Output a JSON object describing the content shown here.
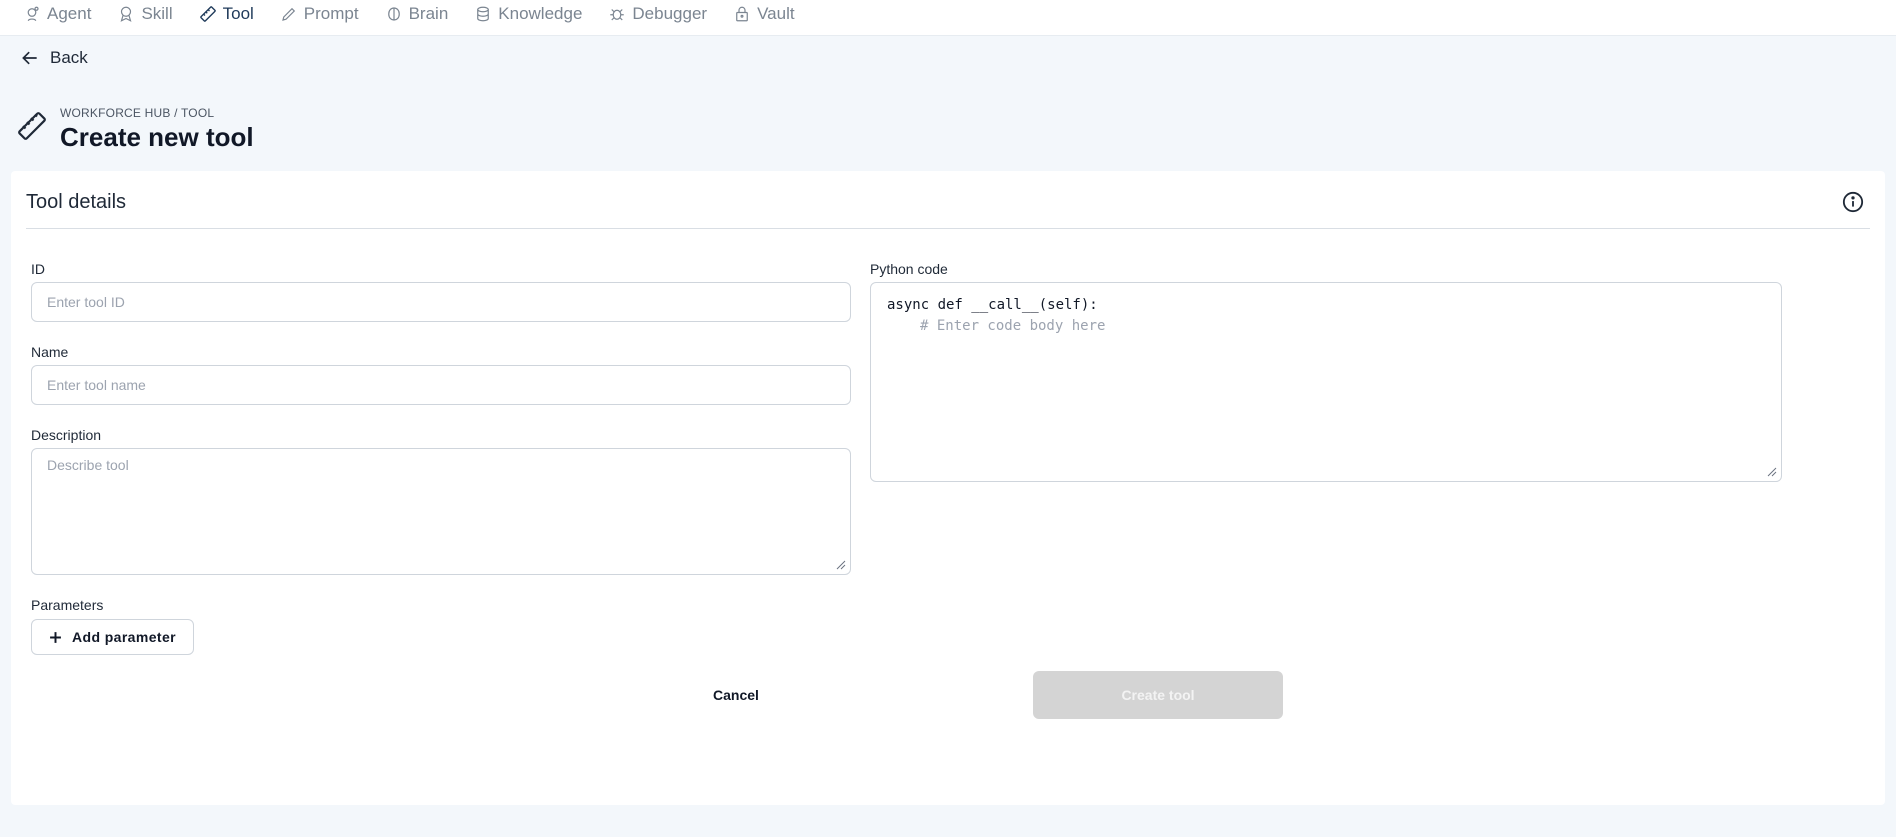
{
  "nav": {
    "items": [
      {
        "label": "Agent",
        "icon": "agent-icon"
      },
      {
        "label": "Skill",
        "icon": "skill-icon"
      },
      {
        "label": "Tool",
        "icon": "tool-icon",
        "active": true
      },
      {
        "label": "Prompt",
        "icon": "prompt-icon"
      },
      {
        "label": "Brain",
        "icon": "brain-icon"
      },
      {
        "label": "Knowledge",
        "icon": "database-icon"
      },
      {
        "label": "Debugger",
        "icon": "bug-icon"
      },
      {
        "label": "Vault",
        "icon": "lock-icon"
      }
    ]
  },
  "back_label": "Back",
  "header": {
    "breadcrumb": "WORKFORCE HUB / TOOL",
    "title": "Create new tool",
    "icon": "ruler-icon"
  },
  "card": {
    "title": "Tool details",
    "id_label": "ID",
    "id_placeholder": "Enter tool ID",
    "name_label": "Name",
    "name_placeholder": "Enter tool name",
    "description_label": "Description",
    "description_placeholder": "Describe tool",
    "code_label": "Python code",
    "code_line1": "async def __call__(self):",
    "code_line2": "# Enter code body here",
    "parameters_label": "Parameters",
    "add_parameter_label": "Add parameter",
    "cancel_label": "Cancel",
    "create_label": "Create tool"
  },
  "colors": {
    "active_nav": "#1f3a5a",
    "inactive_nav": "#7b8591",
    "page_bg": "#f3f7fb",
    "disabled_button": "#d4d4d4"
  }
}
